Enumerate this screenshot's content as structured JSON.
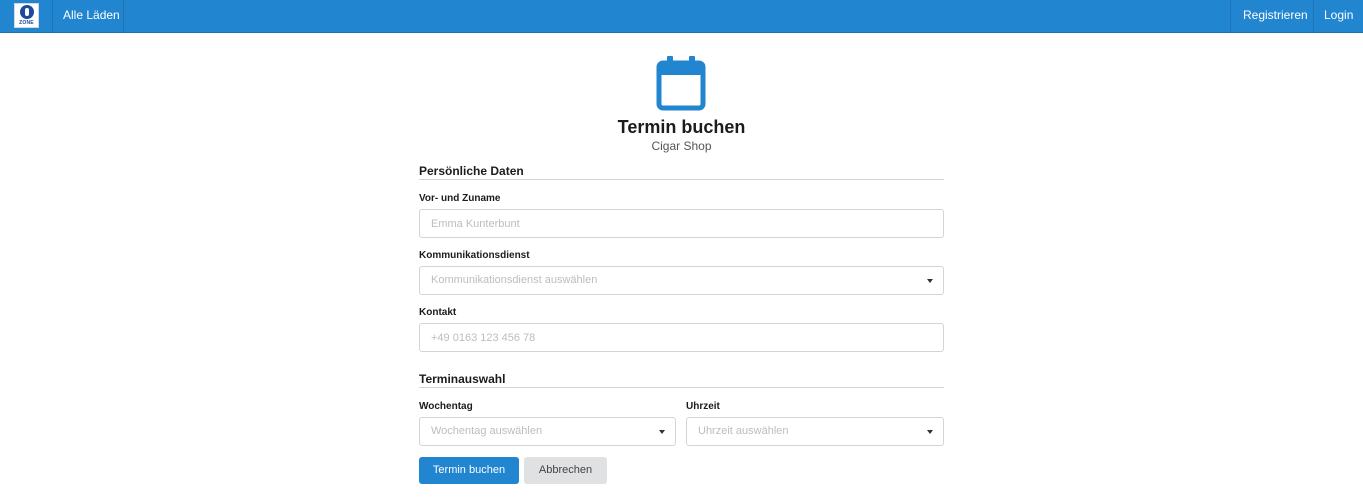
{
  "navbar": {
    "logo_text": "ZONE",
    "all_shops": "Alle Läden",
    "register": "Registrieren",
    "login": "Login"
  },
  "header": {
    "icon": "calendar-icon",
    "title": "Termin buchen",
    "subtitle": "Cigar Shop"
  },
  "personal": {
    "section_title": "Persönliche Daten",
    "name_label": "Vor- und Zuname",
    "name_placeholder": "Emma Kunterbunt",
    "service_label": "Kommunikationsdienst",
    "service_placeholder": "Kommunikationsdienst auswählen",
    "contact_label": "Kontakt",
    "contact_placeholder": "+49 0163 123 456 78"
  },
  "appointment": {
    "section_title": "Terminauswahl",
    "weekday_label": "Wochentag",
    "weekday_placeholder": "Wochentag auswählen",
    "time_label": "Uhrzeit",
    "time_placeholder": "Uhrzeit auswählen"
  },
  "actions": {
    "submit": "Termin buchen",
    "cancel": "Abbrechen"
  },
  "colors": {
    "primary": "#2185d0",
    "secondary": "#e0e1e2"
  }
}
